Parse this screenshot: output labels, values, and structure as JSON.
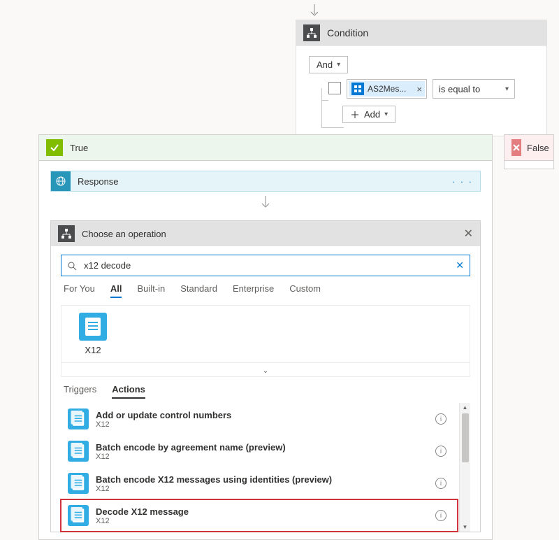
{
  "condition": {
    "title": "Condition",
    "and_label": "And",
    "token_label": "AS2Mes...",
    "operator": "is equal to",
    "add_label": "Add"
  },
  "branches": {
    "true_label": "True",
    "false_label": "False"
  },
  "response": {
    "label": "Response"
  },
  "operation_picker": {
    "title": "Choose an operation",
    "search_value": "x12 decode",
    "category_tabs": [
      "For You",
      "All",
      "Built-in",
      "Standard",
      "Enterprise",
      "Custom"
    ],
    "active_category_index": 1,
    "connector": {
      "name": "X12"
    },
    "ta_tabs": [
      "Triggers",
      "Actions"
    ],
    "active_ta_index": 1,
    "actions": [
      {
        "title": "Add or update control numbers",
        "subtitle": "X12"
      },
      {
        "title": "Batch encode by agreement name (preview)",
        "subtitle": "X12"
      },
      {
        "title": "Batch encode X12 messages using identities (preview)",
        "subtitle": "X12"
      },
      {
        "title": "Decode X12 message",
        "subtitle": "X12"
      }
    ],
    "highlighted_action_index": 3
  }
}
